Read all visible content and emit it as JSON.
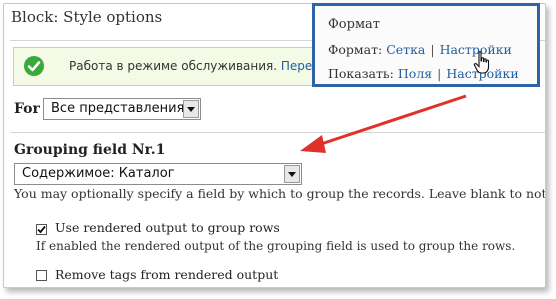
{
  "block_title": "Block: Style options",
  "status": {
    "message": "Работа в режиме обслуживания.",
    "link": "Перекло"
  },
  "display_for": {
    "label": "For",
    "value": "Все представления"
  },
  "grouping": {
    "label": "Grouping field Nr.1",
    "value": "Содержимое: Каталог",
    "help": "You may optionally specify a field by which to group the records. Leave blank to not group."
  },
  "use_rendered": {
    "label": "Use rendered output to group rows",
    "checked": true,
    "description": "If enabled the rendered output of the grouping field is used to group the rows."
  },
  "remove_tags": {
    "label": "Remove tags from rendered output",
    "checked": false
  },
  "popup": {
    "title": "Формат",
    "line1_label": "Формат:",
    "line1_link1": "Сетка",
    "line1_sep": "|",
    "line1_link2": "Настройки",
    "line2_label": "Показать:",
    "line2_link1": "Поля",
    "line2_sep": "|",
    "line2_link2": "Настройки"
  },
  "colors": {
    "link": "#1f5d9c",
    "popup_border": "#2f63a8",
    "annotation_arrow": "#e0302a",
    "status_bg": "#f3fbe6",
    "ok_icon": "#3aa93a"
  }
}
